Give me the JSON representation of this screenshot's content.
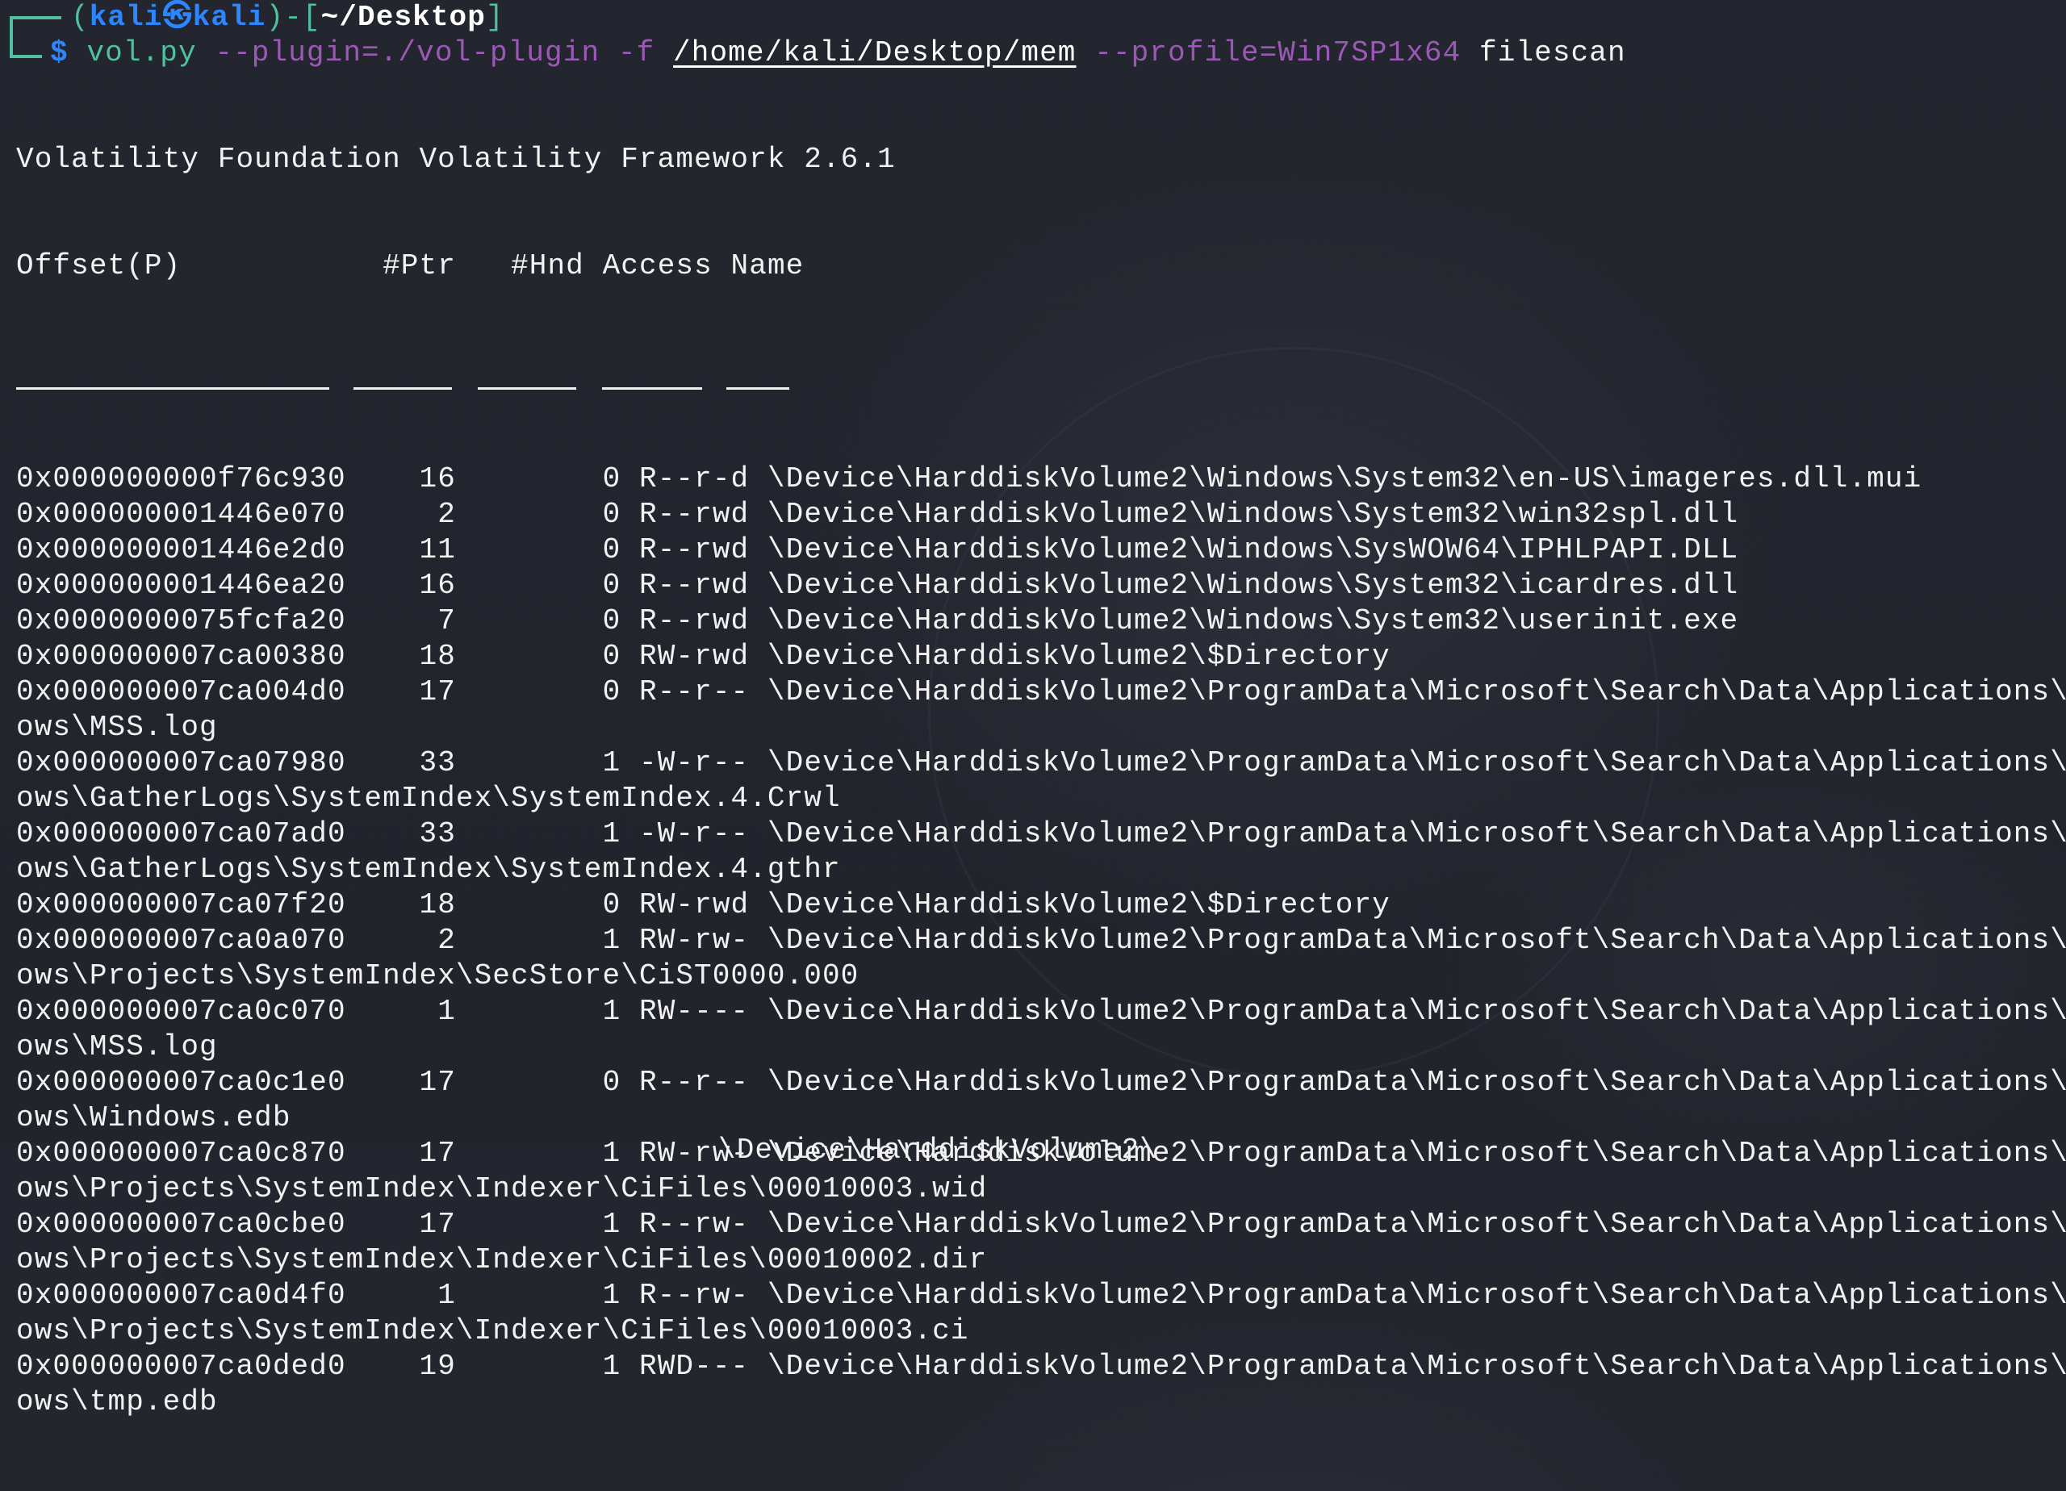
{
  "prompt": {
    "open_paren": "(",
    "user": "kali",
    "at_icon": "㉿",
    "host": "kali",
    "close_paren": ")-[",
    "cwd": "~/Desktop",
    "close_bracket": "]",
    "symbol": "$",
    "command": {
      "program": "vol.py",
      "opt_plugin": "--plugin=./vol-plugin",
      "opt_f": "-f",
      "file_path": "/home/kali/Desktop/mem",
      "opt_profile": "--profile=Win7SP1x64",
      "subcommand": "filescan"
    }
  },
  "banner": "Volatility Foundation Volatility Framework 2.6.1",
  "table": {
    "headers": [
      "Offset(P)",
      "#Ptr",
      "#Hnd",
      "Access",
      "Name"
    ],
    "rows": [
      {
        "offset": "0x000000000f76c930",
        "ptr": "16",
        "hnd": "0",
        "access": "R--r-d",
        "name": "\\Device\\HarddiskVolume2\\Windows\\System32\\en-US\\imageres.dll.mui"
      },
      {
        "offset": "0x000000001446e070",
        "ptr": "2",
        "hnd": "0",
        "access": "R--rwd",
        "name": "\\Device\\HarddiskVolume2\\Windows\\System32\\win32spl.dll"
      },
      {
        "offset": "0x000000001446e2d0",
        "ptr": "11",
        "hnd": "0",
        "access": "R--rwd",
        "name": "\\Device\\HarddiskVolume2\\Windows\\SysWOW64\\IPHLPAPI.DLL"
      },
      {
        "offset": "0x000000001446ea20",
        "ptr": "16",
        "hnd": "0",
        "access": "R--rwd",
        "name": "\\Device\\HarddiskVolume2\\Windows\\System32\\icardres.dll"
      },
      {
        "offset": "0x0000000075fcfa20",
        "ptr": "7",
        "hnd": "0",
        "access": "R--rwd",
        "name": "\\Device\\HarddiskVolume2\\Windows\\System32\\userinit.exe"
      },
      {
        "offset": "0x000000007ca00380",
        "ptr": "18",
        "hnd": "0",
        "access": "RW-rwd",
        "name": "\\Device\\HarddiskVolume2\\$Directory"
      },
      {
        "offset": "0x000000007ca004d0",
        "ptr": "17",
        "hnd": "0",
        "access": "R--r--",
        "name": "\\Device\\HarddiskVolume2\\ProgramData\\Microsoft\\Search\\Data\\Applications\\Wind",
        "wrap": "ows\\MSS.log"
      },
      {
        "offset": "0x000000007ca07980",
        "ptr": "33",
        "hnd": "1",
        "access": "-W-r--",
        "name": "\\Device\\HarddiskVolume2\\ProgramData\\Microsoft\\Search\\Data\\Applications\\Wind",
        "wrap": "ows\\GatherLogs\\SystemIndex\\SystemIndex.4.Crwl"
      },
      {
        "offset": "0x000000007ca07ad0",
        "ptr": "33",
        "hnd": "1",
        "access": "-W-r--",
        "name": "\\Device\\HarddiskVolume2\\ProgramData\\Microsoft\\Search\\Data\\Applications\\Wind",
        "wrap": "ows\\GatherLogs\\SystemIndex\\SystemIndex.4.gthr"
      },
      {
        "offset": "0x000000007ca07f20",
        "ptr": "18",
        "hnd": "0",
        "access": "RW-rwd",
        "name": "\\Device\\HarddiskVolume2\\$Directory"
      },
      {
        "offset": "0x000000007ca0a070",
        "ptr": "2",
        "hnd": "1",
        "access": "RW-rw-",
        "name": "\\Device\\HarddiskVolume2\\ProgramData\\Microsoft\\Search\\Data\\Applications\\Wind",
        "wrap": "ows\\Projects\\SystemIndex\\SecStore\\CiST0000.000"
      },
      {
        "offset": "0x000000007ca0c070",
        "ptr": "1",
        "hnd": "1",
        "access": "RW----",
        "name": "\\Device\\HarddiskVolume2\\ProgramData\\Microsoft\\Search\\Data\\Applications\\Wind",
        "wrap": "ows\\MSS.log"
      },
      {
        "offset": "0x000000007ca0c1e0",
        "ptr": "17",
        "hnd": "0",
        "access": "R--r--",
        "name": "\\Device\\HarddiskVolume2\\ProgramData\\Microsoft\\Search\\Data\\Applications\\Wind",
        "wrap": "ows\\Windows.edb"
      },
      {
        "offset": "0x000000007ca0c870",
        "ptr": "17",
        "hnd": "1",
        "access": "RW-rw-",
        "name": "\\Device\\HarddiskVolume2\\ProgramData\\Microsoft\\Search\\Data\\Applications\\Wind",
        "wrap": "ows\\Projects\\SystemIndex\\Indexer\\CiFiles\\00010003.wid"
      },
      {
        "offset": "0x000000007ca0cbe0",
        "ptr": "17",
        "hnd": "1",
        "access": "R--rw-",
        "name": "\\Device\\HarddiskVolume2\\ProgramData\\Microsoft\\Search\\Data\\Applications\\Wind",
        "wrap": "ows\\Projects\\SystemIndex\\Indexer\\CiFiles\\00010002.dir"
      },
      {
        "offset": "0x000000007ca0d4f0",
        "ptr": "1",
        "hnd": "1",
        "access": "R--rw-",
        "name": "\\Device\\HarddiskVolume2\\ProgramData\\Microsoft\\Search\\Data\\Applications\\Wind",
        "wrap": "ows\\Projects\\SystemIndex\\Indexer\\CiFiles\\00010003.ci"
      },
      {
        "offset": "0x000000007ca0ded0",
        "ptr": "19",
        "hnd": "1",
        "access": "RWD---",
        "name": "\\Device\\HarddiskVolume2\\ProgramData\\Microsoft\\Search\\Data\\Applications\\Wind",
        "wrap": "ows\\tmp.edb"
      }
    ],
    "partial_next_line": "\\Device\\HarddiskVolume2\\"
  },
  "colors": {
    "background": "#23252e",
    "prompt_frame": "#4fc1a0",
    "user_host": "#2e86ff",
    "option": "#9b59b6",
    "text": "#f2f2f2"
  }
}
